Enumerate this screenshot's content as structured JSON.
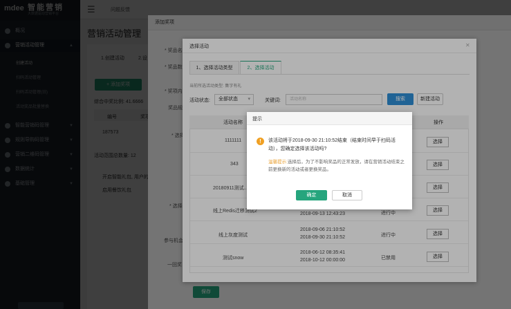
{
  "app": {
    "logo_text": "智能营销",
    "logo_sub": "大数据驱动营销平台",
    "logo_mark": "mdee"
  },
  "sidebar": {
    "items": [
      {
        "label": "概况"
      },
      {
        "label": "营销活动管理",
        "expanded": true
      },
      {
        "label": "智能营销码管理"
      },
      {
        "label": "规则导购码管理"
      },
      {
        "label": "营销二维码管理"
      },
      {
        "label": "数据统计"
      },
      {
        "label": "基础管理"
      }
    ],
    "sub_items": [
      {
        "label": "创建活动"
      },
      {
        "label": "扫码活动管理"
      },
      {
        "label": "扫码活动管理(旧)"
      },
      {
        "label": "活动奖品批量替换"
      }
    ]
  },
  "topbar": {
    "menu_icon": "menu-icon",
    "item": "问题反馈"
  },
  "page": {
    "title": "营销活动管理",
    "steps": [
      "1.创建活动",
      "2.设"
    ],
    "add_prize": "+ 添加奖项",
    "rate_label": "综合中奖比例: 41.6666",
    "col_no": "编号",
    "col_prize": "奖项",
    "row_no": "187573",
    "total": "活动范围总数量: 12",
    "check_label": "开启智能礼包, 用户的",
    "enable_label": "启用餐饮礼包",
    "save": "保存"
  },
  "modal1": {
    "title": "添加奖项",
    "labels": [
      "* 奖品名",
      "* 奖品数",
      "* 奖项内",
      "奖品规",
      "* 选择",
      "* 选择",
      "参与机会",
      "一回奖"
    ]
  },
  "modal2": {
    "title": "选择活动",
    "tab1": "1、选择活动类型",
    "tab2": "2、选择活动",
    "hint": "当前所选活动类型: 集字有礼",
    "status_label": "活动状态:",
    "status_value": "全部状态",
    "keyword_label": "关键词:",
    "keyword_placeholder": "活动名称",
    "search": "搜索",
    "new_activity": "新建活动",
    "headers": {
      "name": "活动名称",
      "action": "操作"
    },
    "rows": [
      {
        "name": "1111111",
        "time": "",
        "status": "",
        "action": "选择"
      },
      {
        "name": "343",
        "time": "",
        "status": "",
        "action": "选择"
      },
      {
        "name": "20180911测试...",
        "time": "",
        "status": "",
        "action": "选择"
      },
      {
        "name": "线上Redis迁移测试2",
        "time": "2018-09-13 12:43:23",
        "status": "进行中",
        "action": "选择"
      },
      {
        "name": "线上灰度测试",
        "time": "2018-09-06 21:10:52",
        "time2": "2018-09-30 21:10:52",
        "status": "进行中",
        "action": "选择"
      },
      {
        "name": "测试snow",
        "time": "2018-06-12 08:35:41",
        "time2": "2018-10-12 00:00:00",
        "status": "已禁用",
        "action": "选择"
      }
    ]
  },
  "dialog": {
    "title": "提示",
    "message": "该活动将于2018-09-30 21:10:52结束（结束时间早于扫码活动），您确定选择该活动吗?",
    "tip_key": "温馨提示:",
    "tip_text": "选择后，为了不影响奖品的正常发放，请在营销活动结束之前更换新的活动或者更换奖品。",
    "ok": "确定",
    "cancel": "取消"
  },
  "colors": {
    "accent": "#26a57d",
    "primary": "#2f8fd6",
    "warn": "#f0a023",
    "sidebar": "#1f2730"
  }
}
